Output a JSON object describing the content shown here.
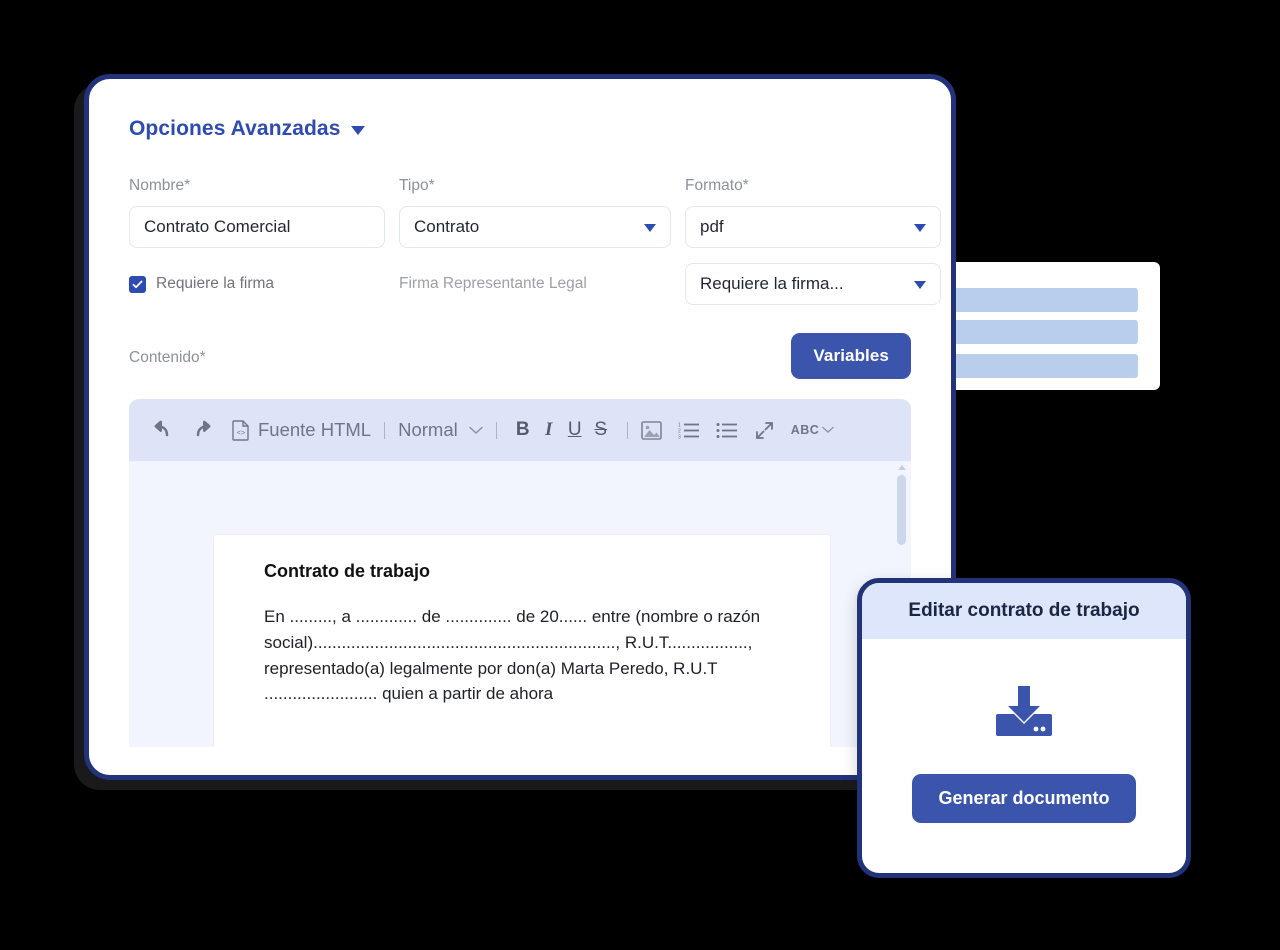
{
  "main_card": {
    "section": {
      "title": "Opciones Avanzadas",
      "caret_icon": "chevron-down-icon"
    },
    "fields": {
      "nombre": {
        "label": "Nombre*",
        "value": "Contrato Comercial"
      },
      "tipo": {
        "label": "Tipo*",
        "value": "Contrato"
      },
      "formato": {
        "label": "Formato*",
        "value": "pdf"
      },
      "requiere_firma": {
        "label": "Requiere la firma",
        "checked": true
      },
      "firma_representante": {
        "label": "Firma Representante Legal"
      },
      "firma_select": {
        "value": "Requiere la firma..."
      }
    },
    "contenido": {
      "label": "Contenido*",
      "variables_button": "Variables"
    },
    "editor": {
      "toolbar": {
        "undo": "undo-icon",
        "redo": "redo-icon",
        "source_label": "Fuente HTML",
        "source_icon": "html-file-icon",
        "format_label": "Normal",
        "bold": "B",
        "italic": "I",
        "underline": "U",
        "strikethrough": "S",
        "image": "image-icon",
        "numbered_list": "numbered-list-icon",
        "bullet_list": "bullet-list-icon",
        "fullscreen": "fullscreen-icon",
        "spellcheck_label": "ABC"
      },
      "document": {
        "title": "Contrato de trabajo",
        "body": "En ........., a ............. de .............. de 20...... entre (nombre o razón social)................................................................, R.U.T................., representado(a) legalmente por don(a) Marta Peredo, R.U.T ........................ quien a partir de ahora"
      }
    }
  },
  "modal": {
    "title": "Editar contrato de trabajo",
    "download_icon": "download-icon",
    "button_label": "Generar documento"
  },
  "colors": {
    "brand_navy": "#22337a",
    "brand_blue": "#3b55ad",
    "title_blue": "#2e4bb1",
    "toolbar_bg": "#dde4f8",
    "editor_bg": "#f2f5fd",
    "modal_header_bg": "#dde6fa",
    "decor_bar": "#b9cdec"
  }
}
